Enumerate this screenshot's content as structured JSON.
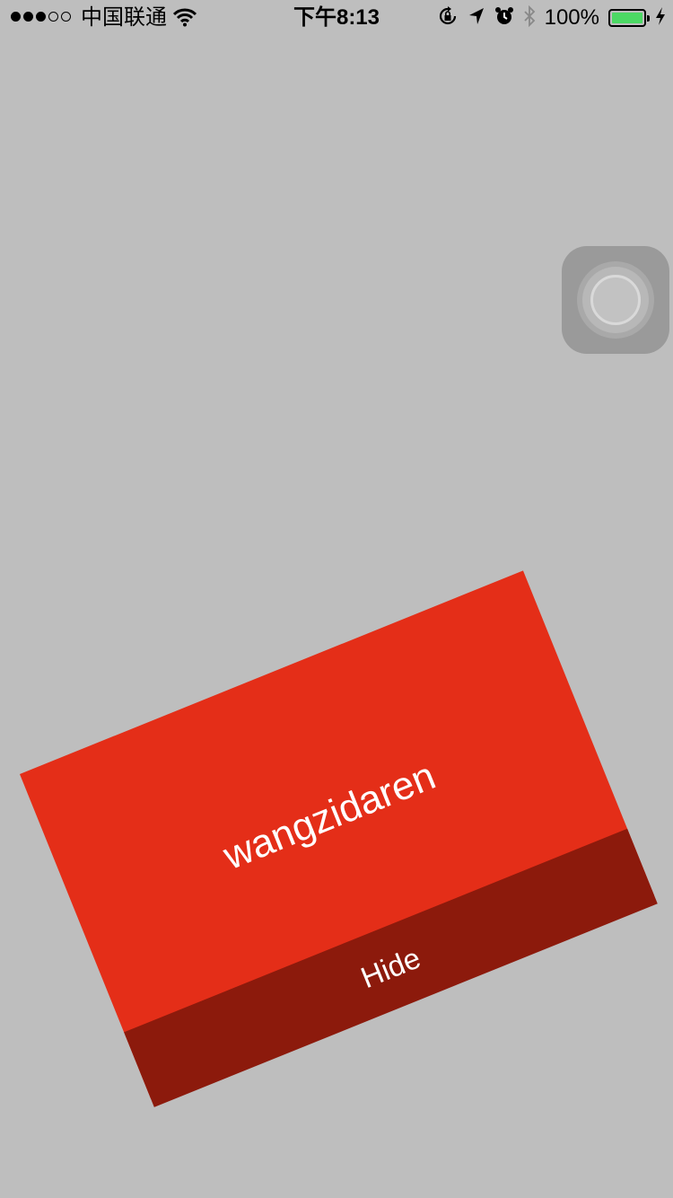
{
  "status_bar": {
    "signal_bars_filled": 3,
    "signal_bars_total": 5,
    "carrier": "中国联通",
    "time": "下午8:13",
    "battery_percent": "100%",
    "battery_color": "#4cd964",
    "icons": [
      "wifi-icon",
      "orientation-lock-icon",
      "location-arrow-icon",
      "alarm-icon",
      "bluetooth-icon",
      "battery-icon",
      "charging-bolt-icon"
    ]
  },
  "assistive_touch": {
    "icon": "assistive-touch-icon"
  },
  "popup": {
    "title": "wangzidaren",
    "hide_label": "Hide",
    "card_color": "#e42e18",
    "button_color": "#8c1a0c"
  },
  "background_color": "#bebebe"
}
